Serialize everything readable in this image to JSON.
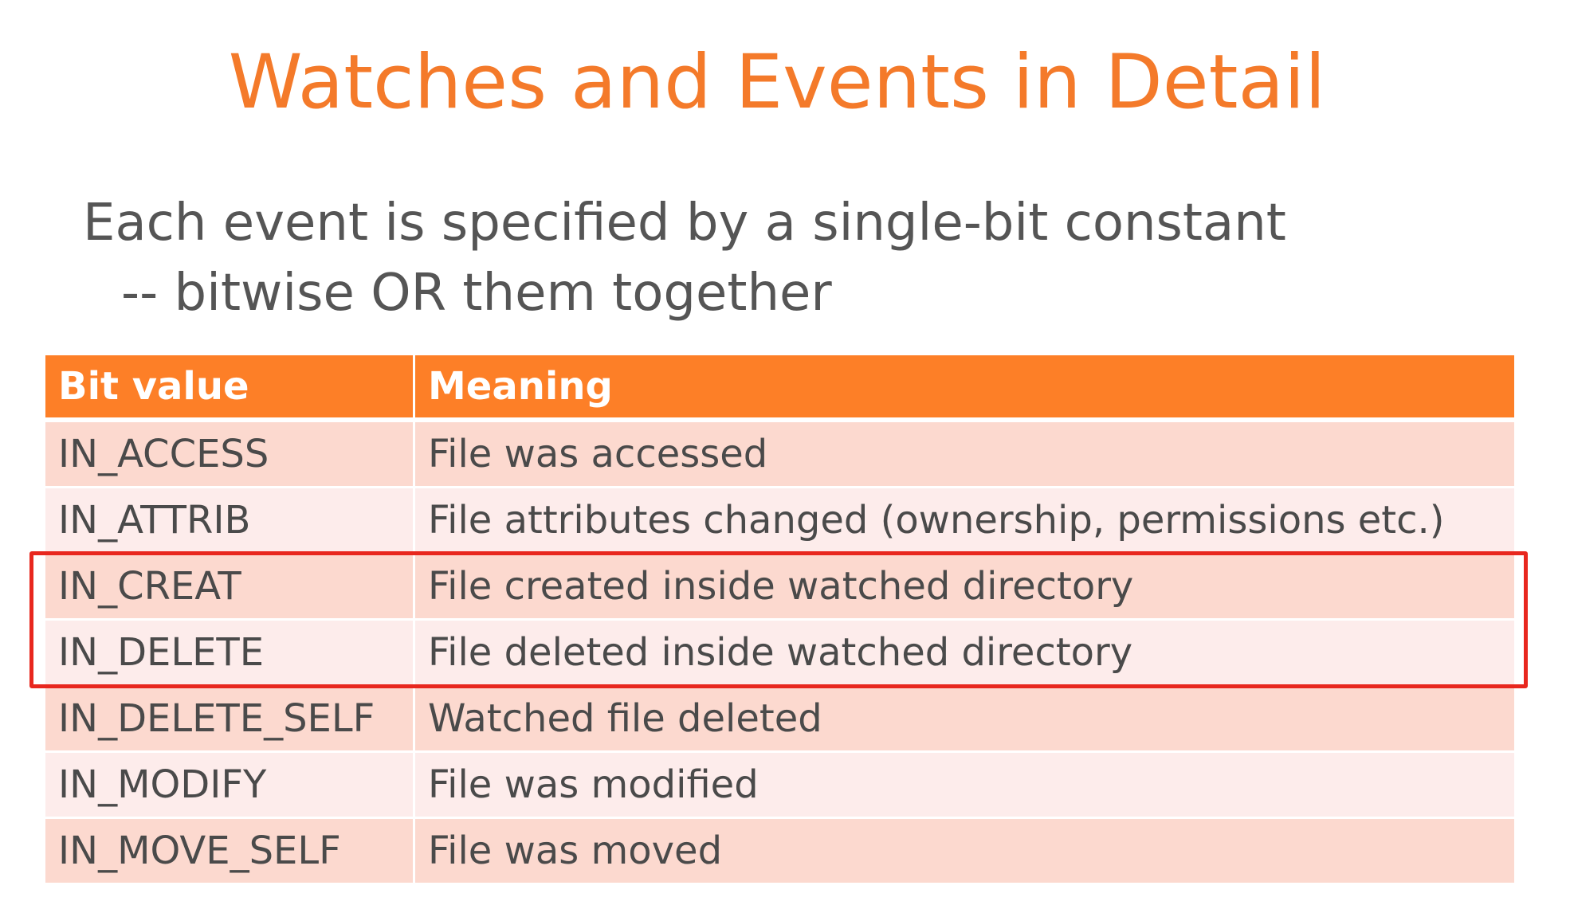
{
  "slide": {
    "title": "Watches and Events in Detail",
    "subtitle_line1": "Each event is specified by a single-bit constant",
    "subtitle_line2": "-- bitwise OR them together"
  },
  "table": {
    "headers": [
      "Bit value",
      "Meaning"
    ],
    "rows": [
      [
        "IN_ACCESS",
        "File was accessed"
      ],
      [
        "IN_ATTRIB",
        "File attributes changed (ownership, permissions etc.)"
      ],
      [
        "IN_CREAT",
        "File created inside watched directory"
      ],
      [
        "IN_DELETE",
        "File deleted inside watched directory"
      ],
      [
        "IN_DELETE_SELF",
        "Watched file deleted"
      ],
      [
        "IN_MODIFY",
        "File was modified"
      ],
      [
        "IN_MOVE_SELF",
        "File was moved"
      ]
    ],
    "highlighted_rows": [
      "IN_CREAT",
      "IN_DELETE"
    ]
  },
  "colors": {
    "title": "#f47a2a",
    "header_bg": "#fd7f27",
    "row_odd": "#fcd9cf",
    "row_even": "#fdeceb",
    "highlight_border": "#e8271e"
  }
}
